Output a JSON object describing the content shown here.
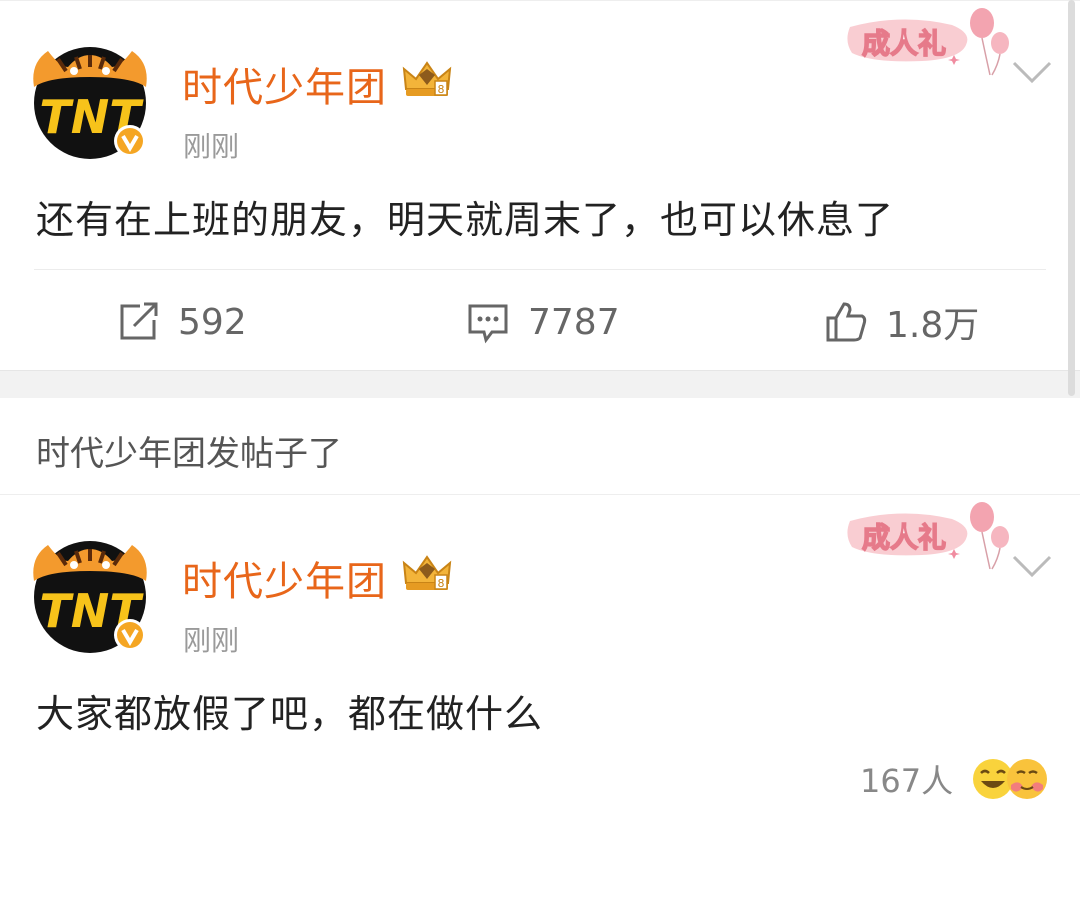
{
  "post1": {
    "username": "时代少年团",
    "timestamp": "刚刚",
    "text": "还有在上班的朋友，明天就周末了，也可以休息了",
    "badge_label": "成人礼",
    "actions": {
      "repost_count": "592",
      "comment_count": "7787",
      "like_count": "1.8万"
    }
  },
  "section": {
    "title": "时代少年团发帖子了"
  },
  "post2": {
    "username": "时代少年团",
    "timestamp": "刚刚",
    "text": "大家都放假了吧，都在做什么",
    "badge_label": "成人礼",
    "reactions": {
      "count": "167人"
    }
  },
  "colors": {
    "username": "#e8661a",
    "verified": "#f5a623",
    "icon_gray": "#666666"
  },
  "icons": [
    "repost-icon",
    "comment-icon",
    "like-icon",
    "chevron-down-icon",
    "crown-icon",
    "verified-icon"
  ]
}
